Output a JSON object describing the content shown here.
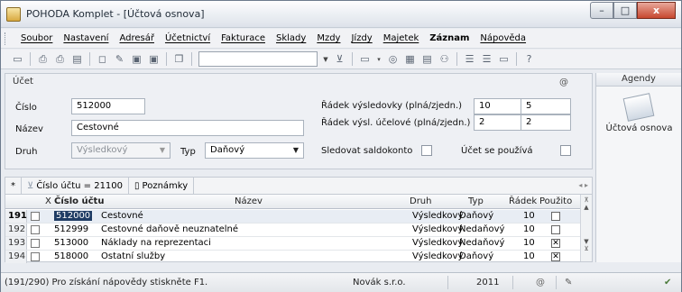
{
  "window": {
    "title": "POHODA Komplet - [Účtová osnova]",
    "minimize": "–",
    "maximize": "□",
    "close": "x"
  },
  "menu": [
    {
      "label": "Soubor"
    },
    {
      "label": "Nastavení"
    },
    {
      "label": "Adresář"
    },
    {
      "label": "Účetnictví"
    },
    {
      "label": "Fakturace"
    },
    {
      "label": "Sklady"
    },
    {
      "label": "Mzdy"
    },
    {
      "label": "Jízdy"
    },
    {
      "label": "Majetek"
    },
    {
      "label": "Záznam"
    },
    {
      "label": "Nápověda"
    }
  ],
  "toolbar": {
    "combo_value": ""
  },
  "form": {
    "legend": "Účet",
    "at_symbol": "@",
    "cislo_label": "Číslo",
    "cislo_value": "512000",
    "nazev_label": "Název",
    "nazev_value": "Cestovné",
    "druh_label": "Druh",
    "druh_value": "Výsledkový",
    "typ_label": "Typ",
    "typ_value": "Daňový",
    "radek_vysl_label": "Řádek výsledovky (plná/zjedn.)",
    "radek_vysl_plna": "10",
    "radek_vysl_zjedn": "5",
    "radek_ucel_label": "Řádek výsl. účelové (plná/zjedn.)",
    "radek_ucel_plna": "2",
    "radek_ucel_zjedn": "2",
    "saldokonto_label": "Sledovat saldokonto",
    "pouziva_label": "Účet se používá"
  },
  "agendy": {
    "header": "Agendy",
    "item_label": "Účtová osnova"
  },
  "grid": {
    "filter_star": "*",
    "filter_text": "Číslo účtu = 21100",
    "notes_tab": "Poznámky",
    "columns": {
      "x": "X",
      "cislo": "Číslo účtu",
      "nazev": "Název",
      "druh": "Druh",
      "typ": "Typ",
      "radek": "Řádek",
      "pouzito": "Použito"
    },
    "rows": [
      {
        "num": "191",
        "cislo": "512000",
        "nazev": "Cestovné",
        "druh": "Výsledkový",
        "typ": "Daňový",
        "radek": "10",
        "pouzito": false,
        "selected": true
      },
      {
        "num": "192",
        "cislo": "512999",
        "nazev": "Cestovné daňově neuznatelné",
        "druh": "Výsledkový",
        "typ": "Nedaňový",
        "radek": "10",
        "pouzito": false,
        "selected": false
      },
      {
        "num": "193",
        "cislo": "513000",
        "nazev": "Náklady na reprezentaci",
        "druh": "Výsledkový",
        "typ": "Nedaňový",
        "radek": "10",
        "pouzito": true,
        "selected": false
      },
      {
        "num": "194",
        "cislo": "518000",
        "nazev": "Ostatní služby",
        "druh": "Výsledkový",
        "typ": "Daňový",
        "radek": "10",
        "pouzito": true,
        "selected": false
      }
    ]
  },
  "status": {
    "hint": "(191/290) Pro získání nápovědy stiskněte F1.",
    "company": "Novák s.r.o.",
    "year": "2011",
    "at": "@"
  }
}
